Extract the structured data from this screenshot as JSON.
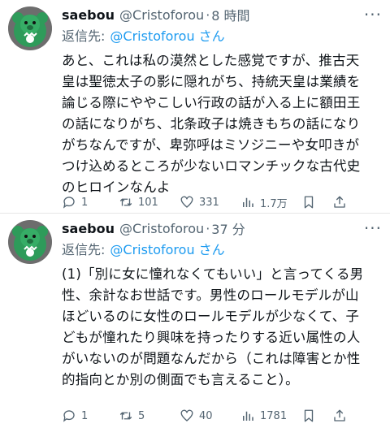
{
  "posts": [
    {
      "name": "saebou",
      "handle": "@Cristoforou",
      "separator": "·",
      "time": "8 時間",
      "reply_label": "返信先:",
      "reply_mention": "@Cristoforou さん",
      "text": "あと、これは私の漠然とした感覚ですが、推古天\n皇は聖徳太子の影に隠れがち、持統天皇は業績を\n論じる際にややこしい行政の話が入る上に額田王\nの話になりがち、北条政子は焼きもちの話になり\nがちなんですが、卑弥呼はミソジニーや女叩きが\nつけ込めるところが少ないロマンチックな古代史\nのヒロインなんよ",
      "replies": "1",
      "retweets": "101",
      "likes": "331",
      "views": "1.7万"
    },
    {
      "name": "saebou",
      "handle": "@Cristoforou",
      "separator": "·",
      "time": "37 分",
      "reply_label": "返信先:",
      "reply_mention": "@Cristoforou さん",
      "text": "(1)「別に女に憧れなくてもいい」と言ってくる男\n性、余計なお世話です。男性のロールモデルが山\nほどいるのに女性のロールモデルが少なくて、子\nどもが憧れたり興味を持ったりする近い属性の人\nがいないのが問題なんだから（これは障害とか性\n的指向とか別の側面でも言えること）。",
      "replies": "1",
      "retweets": "5",
      "likes": "40",
      "views": "1781"
    }
  ],
  "more_icon": "ellipsis-icon",
  "colors": {
    "link": "#1d9bf0",
    "muted": "#536471",
    "text": "#0f1419",
    "avatar_bear": "#2e9b5a"
  }
}
